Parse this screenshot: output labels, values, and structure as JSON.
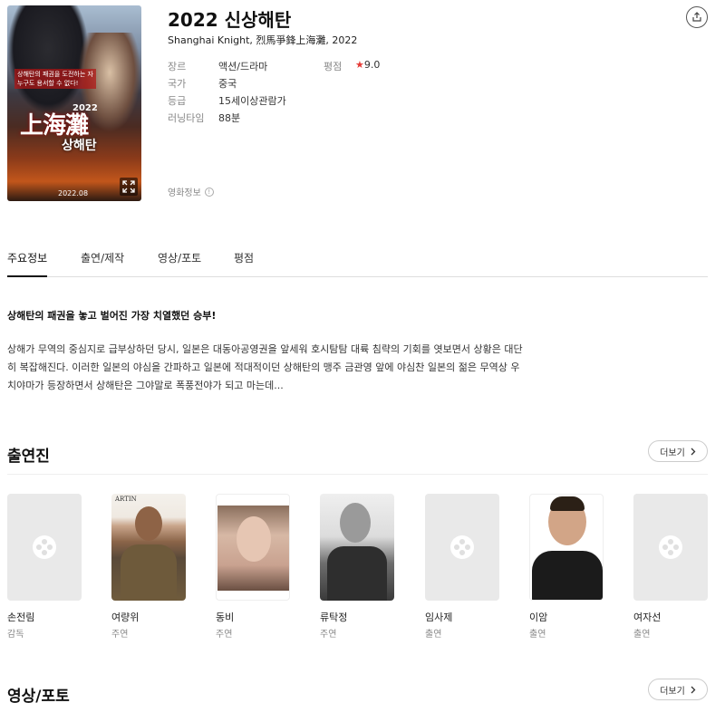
{
  "movie": {
    "title": "2022 신상해탄",
    "subtitle": "Shanghai Knight, 烈馬爭鋒上海灘, 2022",
    "info_label": "영화정보"
  },
  "poster": {
    "title_big": "上海灘",
    "title_small": "상해탄",
    "year": "2022",
    "tag_line1": "상해탄의 패권을 도전하는 자",
    "tag_line2": "누구도 용서할 수 없다!",
    "date": "2022.08"
  },
  "details": [
    {
      "label": "장르",
      "value": "액션/드라마"
    },
    {
      "label": "국가",
      "value": "중국"
    },
    {
      "label": "등급",
      "value": "15세이상관람가"
    },
    {
      "label": "러닝타임",
      "value": "88분"
    }
  ],
  "rating": {
    "label": "평점",
    "star": "★",
    "value": "9.0"
  },
  "tabs": [
    {
      "label": "주요정보"
    },
    {
      "label": "출연/제작"
    },
    {
      "label": "영상/포토"
    },
    {
      "label": "평점"
    }
  ],
  "synopsis": {
    "headline": "상해탄의 패권을 놓고 벌어진 가장 치열했던 승부!",
    "body": "상해가 무역의 중심지로 급부상하던 당시, 일본은 대동아공영권을 앞세워 호시탐탐 대륙 침략의 기회를 엿보면서 상황은 대단히 복잡해진다. 이러한 일본의 야심을 간파하고 일본에 적대적이던 상해탄의 맹주 금관영 앞에 야심찬 일본의 젊은 무역상 우치야마가 등장하면서 상해탄은 그야말로 폭풍전야가 되고 마는데..."
  },
  "cast_section": {
    "title": "출연진",
    "more": "더보기"
  },
  "cast": [
    {
      "name": "손전림",
      "role": "감독",
      "photo": "placeholder"
    },
    {
      "name": "여량위",
      "role": "주연",
      "photo": "man-suit"
    },
    {
      "name": "동비",
      "role": "주연",
      "photo": "woman"
    },
    {
      "name": "류탁정",
      "role": "주연",
      "photo": "man-bw"
    },
    {
      "name": "임사제",
      "role": "출연",
      "photo": "placeholder"
    },
    {
      "name": "이암",
      "role": "출연",
      "photo": "man-black"
    },
    {
      "name": "여자선",
      "role": "출연",
      "photo": "placeholder"
    }
  ],
  "media_section": {
    "title": "영상/포토",
    "more": "더보기"
  }
}
